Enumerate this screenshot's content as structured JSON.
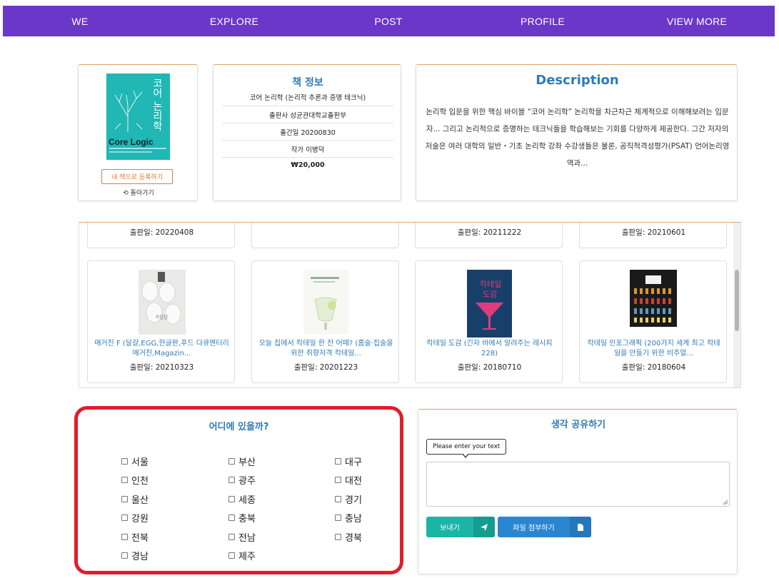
{
  "nav": {
    "items": [
      "WE",
      "EXPLORE",
      "POST",
      "PROFILE",
      "VIEW MORE"
    ]
  },
  "book": {
    "cover_title_ko": "코어 논리학",
    "cover_title_en": "Core Logic",
    "register_label": "내 책으로 등록하기",
    "back_label": "돌아가기"
  },
  "info": {
    "title": "책 정보",
    "rows": [
      "코어 논리학 (논리적 추론과 증명 테크닉)",
      "출판사 성균관대학교출판부",
      "출간일 20200830",
      "작가 이병덕",
      "₩20,000"
    ]
  },
  "description": {
    "title": "Description",
    "text": "논리학 입문을 위한 핵심 바이블 “코어 논리학” 논리학을 차근차근 체계적으로 이해해보려는 입문자... 그리고 논리적으로 증명하는 테크닉들을 학습해보는 기회를 다양하게 제공한다. 그간 저자의 저술은 여러 대학의 일반・기초 논리학 강좌 수강생들은 물론, 공직적격성평가(PSAT) 언어논리영역과..."
  },
  "book_list": {
    "top_row": [
      {
        "date": "출판일: 20220408"
      },
      {
        "date": ""
      },
      {
        "date": "출판일: 20211222"
      },
      {
        "date": "출판일: 20210601"
      }
    ],
    "bottom_row": [
      {
        "title": "매거진 F (달걀,EGG,한글판,푸드 다큐멘터리 매거진,Magazin...",
        "date": "출판일: 20210323"
      },
      {
        "title": "오늘 집에서 칵테일 한 잔 어때? (홈술·집술을 위한 취향저격 칵테일...",
        "date": "출판일: 20201223"
      },
      {
        "title": "칵테일 도감 (긴자 바에서 알려주는 레시피 228)",
        "date": "출판일: 20180710"
      },
      {
        "title": "칵테일 인포그래픽 (200가지 세계 최고 칵테일을 만들기 위한 비주얼...",
        "date": "출판일: 20180604"
      }
    ]
  },
  "location": {
    "title": "어디에 있을까?",
    "regions": [
      "서울",
      "부산",
      "대구",
      "인천",
      "광주",
      "대전",
      "울산",
      "세종",
      "경기",
      "강원",
      "충북",
      "충남",
      "전북",
      "전남",
      "경북",
      "경남",
      "제주"
    ]
  },
  "share": {
    "title": "생각 공유하기",
    "tooltip": "Please enter your text",
    "input_value": "",
    "send_label": "보내기",
    "attach_label": "파일 첨부하기"
  },
  "colors": {
    "nav_bg": "#6a37c8",
    "accent_blue": "#2f7ab8",
    "highlight_red": "#e21c2c",
    "send_teal": "#1bb5a7",
    "attach_blue": "#2a86d1"
  }
}
